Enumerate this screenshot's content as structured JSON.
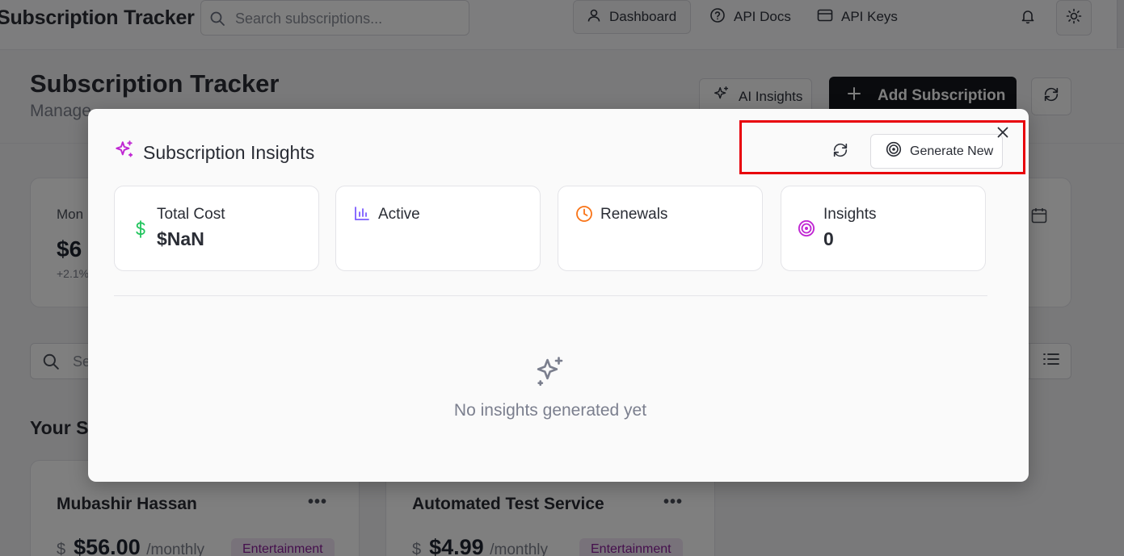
{
  "app": {
    "brand": "Subscription Tracker",
    "search_placeholder": "Search subscriptions...",
    "nav": {
      "dashboard": "Dashboard",
      "api_docs": "API Docs",
      "api_keys": "API Keys"
    }
  },
  "page": {
    "title": "Subscription Tracker",
    "subtitle_visible": "Manage",
    "ai_insights_label": "AI Insights",
    "add_subscription_label": "Add Subscription",
    "stat": {
      "label_visible": "Mon",
      "value_visible": "$6",
      "delta_visible": "+2.1%"
    },
    "search_placeholder_visible": "Se",
    "section_title_visible": "Your S",
    "subscriptions": [
      {
        "name": "Mubashir Hassan",
        "currency": "$",
        "price": "$56.00",
        "period": "/monthly",
        "category": "Entertainment"
      },
      {
        "name": "Automated Test Service",
        "currency": "$",
        "price": "$4.99",
        "period": "/monthly",
        "category": "Entertainment"
      }
    ]
  },
  "modal": {
    "title": "Subscription Insights",
    "generate_label": "Generate New",
    "cards": [
      {
        "label": "Total Cost",
        "value": "$NaN",
        "icon": "dollar-icon",
        "color": "#22c55e"
      },
      {
        "label": "Active",
        "value": "",
        "icon": "bar-chart-icon",
        "color": "#7c5cff"
      },
      {
        "label": "Renewals",
        "value": "",
        "icon": "clock-icon",
        "color": "#f97316"
      },
      {
        "label": "Insights",
        "value": "0",
        "icon": "target-icon",
        "color": "#c026d3"
      }
    ],
    "empty_text": "No insights generated yet"
  },
  "colors": {
    "highlight": "#e8000b",
    "sparkle_accent": "#c026d3",
    "primary_button": "#15171d",
    "badge_bg": "#f1e4f4",
    "badge_text": "#8a1f9a"
  }
}
